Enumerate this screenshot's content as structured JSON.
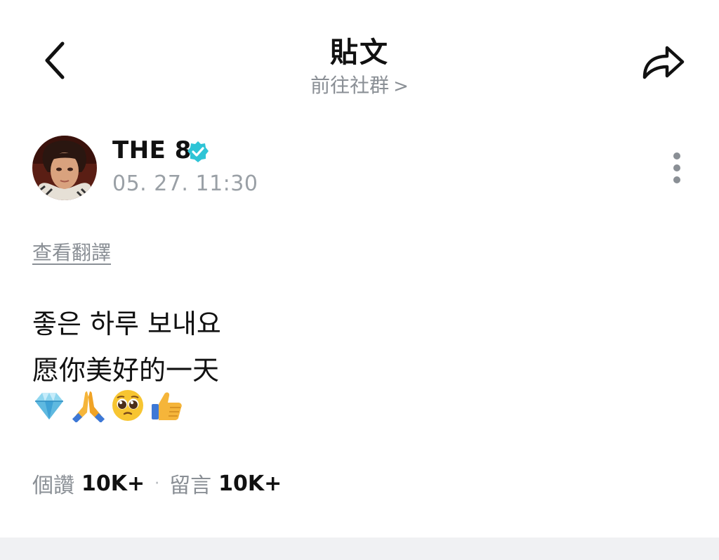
{
  "header": {
    "title": "貼文",
    "community_link": "前往社群",
    "community_chevron": ">"
  },
  "post": {
    "author_name": "THE 8",
    "timestamp": "05. 27. 11:30",
    "translate_label": "查看翻譯",
    "body_lines": [
      "좋은 하루 보내요",
      "愿你美好的一天"
    ],
    "emojis": [
      "gem-icon",
      "folded-hands-icon",
      "pleading-face-icon",
      "thumbs-up-icon"
    ]
  },
  "stats": {
    "likes_label": "個讚",
    "likes_value": "10K+",
    "separator": "·",
    "comments_label": "留言",
    "comments_value": "10K+"
  },
  "colors": {
    "verified_badge": "#2ec4d6",
    "muted_text": "#8a8f95",
    "bottom_band": "#f0f1f3"
  }
}
